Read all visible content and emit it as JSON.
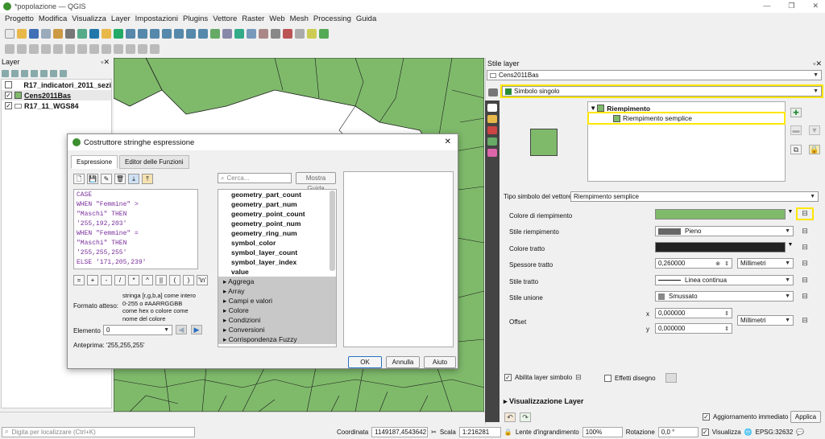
{
  "window": {
    "title": "*popolazione — QGIS",
    "controls": [
      "—",
      "❐",
      "✕"
    ]
  },
  "menu": [
    "Progetto",
    "Modifica",
    "Visualizza",
    "Layer",
    "Impostazioni",
    "Plugins",
    "Vettore",
    "Raster",
    "Web",
    "Mesh",
    "Processing",
    "Guida"
  ],
  "layers_panel": {
    "title": "Layer",
    "items": [
      {
        "label": "R17_indicatori_2011_sezi",
        "checked": false
      },
      {
        "label": "Cens2011Bas",
        "checked": true
      },
      {
        "label": "R17_11_WGS84",
        "checked": true
      }
    ]
  },
  "style_panel": {
    "title": "Stile layer",
    "layer_combo": "Cens2011Bas",
    "renderer": "Simbolo singolo",
    "symbol_tree": {
      "parent": "Riempimento",
      "child": "Riempimento semplice"
    },
    "symbol_layer_type_label": "Tipo simbolo del vettore",
    "symbol_layer_type": "Riempimento semplice",
    "fill_color_label": "Colore di riempimento",
    "fill_style_label": "Stile riempimento",
    "fill_style": "Pieno",
    "stroke_color_label": "Colore tratto",
    "stroke_width_label": "Spessore tratto",
    "stroke_width": "0,260000",
    "stroke_unit": "Millimetri",
    "stroke_style_label": "Stile tratto",
    "stroke_style": "Linea continua",
    "join_style_label": "Stile unione",
    "join_style": "Smussato",
    "offset_label": "Offset",
    "offset_x_label": "x",
    "offset_x": "0,000000",
    "offset_y_label": "y",
    "offset_y": "0,000000",
    "offset_unit": "Millimetri",
    "enable_layer_label": "Abilita layer simbolo",
    "draw_effects_label": "Effetti disegno",
    "rendering_section": "Visualizzazione Layer",
    "live_update_label": "Aggiornamento immediato",
    "apply_label": "Applica",
    "fill_color": "#7fba6b",
    "stroke_color": "#222222"
  },
  "dialog": {
    "title": "Costruttore stringhe espressione",
    "tabs": [
      "Espressione",
      "Editor delle Funzioni"
    ],
    "expression_lines": [
      {
        "t": "CASE",
        "c": "kw"
      },
      {
        "t": "WHEN  \"Femmine\" >",
        "c": "mix"
      },
      {
        "t": "\"Maschi\" THEN",
        "c": "mix"
      },
      {
        "t": "'255,192,203'",
        "c": "str"
      },
      {
        "t": "WHEN \"Femmine\" =",
        "c": "mix"
      },
      {
        "t": "\"Maschi\" THEN",
        "c": "mix"
      },
      {
        "t": "'255,255,255'",
        "c": "str"
      },
      {
        "t": "ELSE '171,205,239'",
        "c": "mix"
      }
    ],
    "operators": [
      "=",
      "+",
      "-",
      "/",
      "*",
      "^",
      "||",
      "(",
      ")",
      "'\\n'"
    ],
    "expected_format_label": "Formato atteso:",
    "expected_format_text": "stringa [r,g,b,a] come intero 0-255 o #AARRGGBB come hex o colore come nome del colore",
    "element_label": "Elemento",
    "element_value": "0",
    "preview_label": "Anteprima:",
    "preview_value": "'255,255,255'",
    "search_placeholder": "Cerca...",
    "show_help_label": "Mostra Guida",
    "functions": [
      "geometry_part_count",
      "geometry_part_num",
      "geometry_point_count",
      "geometry_point_num",
      "geometry_ring_num",
      "symbol_color",
      "symbol_layer_count",
      "symbol_layer_index",
      "value"
    ],
    "groups": [
      "Aggrega",
      "Array",
      "Campi e valori",
      "Colore",
      "Condizioni",
      "Conversioni",
      "Corrispondenza Fuzzy"
    ],
    "ok_label": "OK",
    "cancel_label": "Annulla",
    "help_label": "Aiuto"
  },
  "statusbar": {
    "locator_placeholder": "Digita per localizzare (Ctrl+K)",
    "coordinate_label": "Coordinata",
    "coordinate": "1149187,4543642",
    "scale_label": "Scala",
    "scale": "1:216281",
    "magnifier_label": "Lente d'ingrandimento",
    "magnifier": "100%",
    "rotation_label": "Rotazione",
    "rotation": "0,0 °",
    "render_label": "Visualizza",
    "crs": "EPSG:32632"
  }
}
